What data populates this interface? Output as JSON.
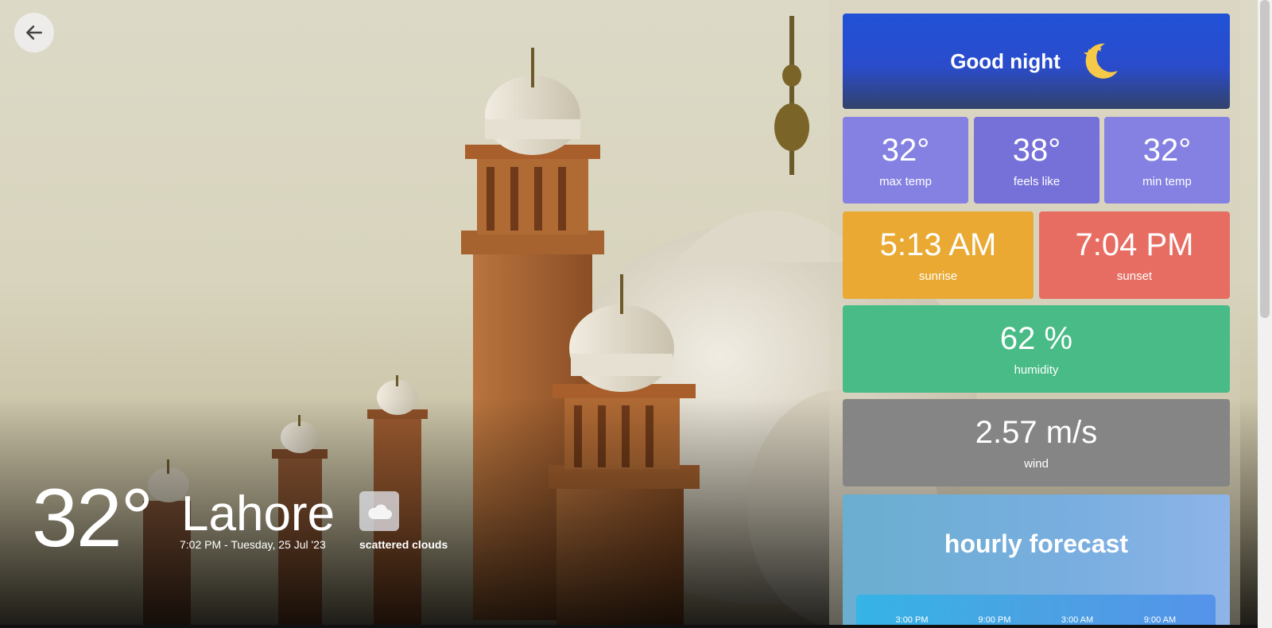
{
  "back": {
    "icon": "arrow-left-icon"
  },
  "current": {
    "temperature": "32°",
    "city": "Lahore",
    "datetime": "7:02 PM - Tuesday, 25 Jul '23",
    "condition": "scattered clouds",
    "condition_icon": "cloud-icon"
  },
  "greeting": {
    "text": "Good night",
    "icon": "moon-stars-icon"
  },
  "temps": {
    "max": {
      "value": "32°",
      "label": "max temp"
    },
    "feels": {
      "value": "38°",
      "label": "feels like"
    },
    "min": {
      "value": "32°",
      "label": "min temp"
    }
  },
  "sun": {
    "sunrise": {
      "value": "5:13 AM",
      "label": "sunrise"
    },
    "sunset": {
      "value": "7:04 PM",
      "label": "sunset"
    }
  },
  "humidity": {
    "value": "62 %",
    "label": "humidity"
  },
  "wind": {
    "value": "2.57 m/s",
    "label": "wind"
  },
  "hourly": {
    "title": "hourly forecast",
    "slots": [
      "3:00 PM",
      "9:00 PM",
      "3:00 AM",
      "9:00 AM"
    ]
  },
  "colors": {
    "greeting": "#2151d6",
    "max_temp": "#8581e2",
    "feels_like": "#7670d9",
    "sunrise": "#e9a933",
    "sunset": "#e76d62",
    "humidity": "#48bb86",
    "wind": "#858585",
    "hourly": "#79aee0"
  }
}
